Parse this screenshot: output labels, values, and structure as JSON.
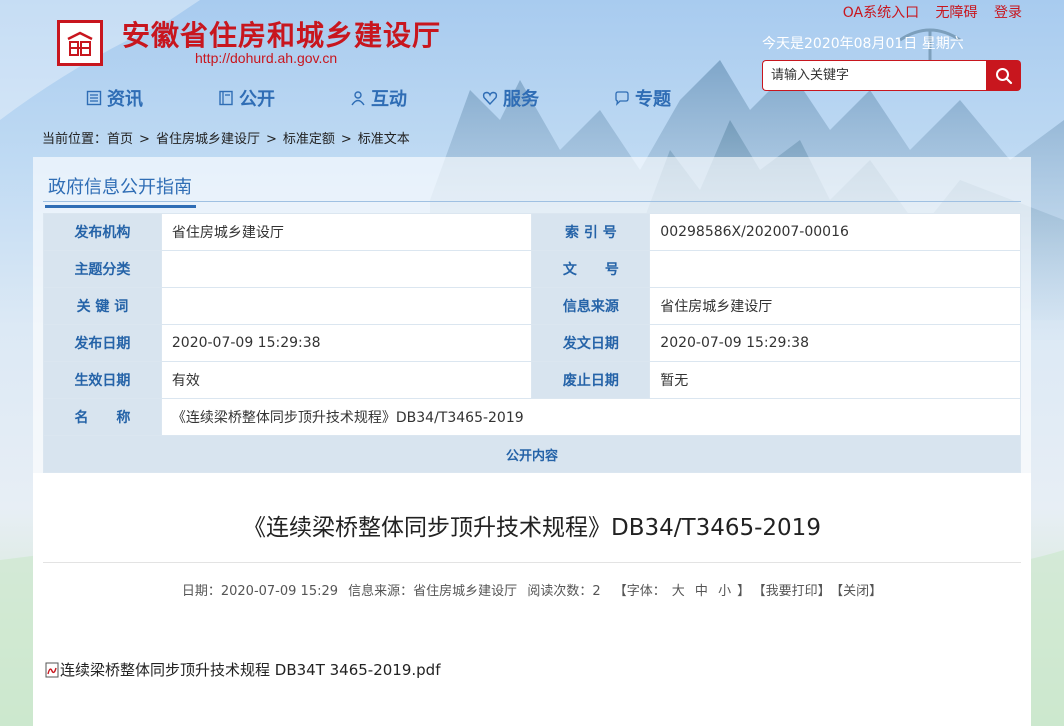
{
  "site": {
    "title": "安徽省住房和城乡建设厅",
    "url": "http://dohurd.ah.gov.cn"
  },
  "top_links": [
    "OA系统入口",
    "无障碍",
    "登录"
  ],
  "date_line": "今天是2020年08月01日 星期六",
  "search": {
    "placeholder": "请输入关键字",
    "icon": "search-icon"
  },
  "nav": [
    {
      "label": "资讯",
      "icon": "list-icon"
    },
    {
      "label": "公开",
      "icon": "book-icon"
    },
    {
      "label": "互动",
      "icon": "people-icon"
    },
    {
      "label": "服务",
      "icon": "heart-icon"
    },
    {
      "label": "专题",
      "icon": "chat-icon"
    }
  ],
  "breadcrumb": {
    "prefix": "当前位置：",
    "items": [
      "首页",
      "省住房城乡建设厅",
      "标准定额",
      "标准文本"
    ]
  },
  "guide_title": "政府信息公开指南",
  "info": {
    "rows": [
      {
        "l1": "发布机构",
        "v1": "省住房城乡建设厅",
        "l2": "索 引 号",
        "v2": "00298586X/202007-00016"
      },
      {
        "l1": "主题分类",
        "v1": "",
        "l2": "文　　号",
        "v2": ""
      },
      {
        "l1": "关 键 词",
        "v1": "",
        "l2": "信息来源",
        "v2": "省住房城乡建设厅"
      },
      {
        "l1": "发布日期",
        "v1": "2020-07-09 15:29:38",
        "l2": "发文日期",
        "v2": "2020-07-09 15:29:38"
      },
      {
        "l1": "生效日期",
        "v1": "有效",
        "l2": "废止日期",
        "v2": "暂无"
      }
    ],
    "name_label": "名　　称",
    "name_value": "《连续梁桥整体同步顶升技术规程》DB34/T3465-2019",
    "content_header": "公开内容"
  },
  "doc": {
    "title": "《连续梁桥整体同步顶升技术规程》DB34/T3465-2019",
    "date": "日期：2020-07-09 15:29",
    "source": "信息来源：省住房城乡建设厅",
    "reads": "阅读次数：2",
    "font_label": "【字体：",
    "font_big": "大",
    "font_mid": "中",
    "font_small": "小",
    "font_end": "】",
    "print": "【我要打印】",
    "close": "【关闭】"
  },
  "attachment": {
    "name": "连续梁桥整体同步顶升技术规程 DB34T 3465-2019.pdf",
    "icon": "pdf-icon"
  },
  "colors": {
    "brand_red": "#c8161e",
    "link_blue": "#2f6db5",
    "label_bg": "#d8e4ef"
  }
}
